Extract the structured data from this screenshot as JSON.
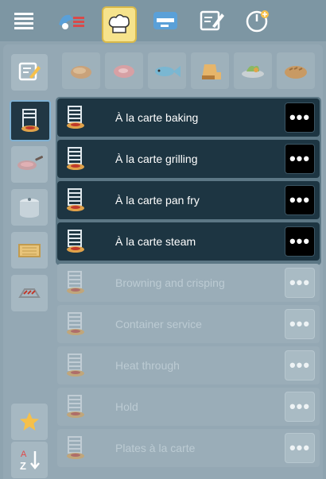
{
  "toolbar": {
    "buttons": [
      {
        "name": "menu",
        "icon": "hamburger-menu-icon"
      },
      {
        "name": "cook",
        "icon": "cooking-wizard-icon"
      },
      {
        "name": "chef",
        "icon": "chef-hat-icon",
        "active": true
      },
      {
        "name": "cabinet",
        "icon": "oven-cabinet-icon"
      },
      {
        "name": "edit",
        "icon": "edit-note-icon"
      },
      {
        "name": "timer",
        "icon": "timer-plus-icon"
      }
    ]
  },
  "categories": [
    {
      "name": "poultry",
      "icon": "poultry-icon"
    },
    {
      "name": "meat",
      "icon": "meat-icon"
    },
    {
      "name": "fish",
      "icon": "fish-icon"
    },
    {
      "name": "dessert",
      "icon": "dessert-icon"
    },
    {
      "name": "vegetables",
      "icon": "vegetables-icon"
    },
    {
      "name": "bakery",
      "icon": "bread-icon"
    }
  ],
  "sidebar": {
    "items": [
      {
        "name": "edit-recipe",
        "icon": "edit-recipe-icon"
      },
      {
        "name": "a-la-carte",
        "icon": "a-la-carte-icon",
        "active": true
      },
      {
        "name": "pan",
        "icon": "pan-icon"
      },
      {
        "name": "pot",
        "icon": "pot-icon"
      },
      {
        "name": "baking-tray",
        "icon": "baking-tray-icon"
      },
      {
        "name": "grill",
        "icon": "grill-icon"
      },
      {
        "name": "favorites",
        "icon": "star-icon"
      },
      {
        "name": "sort",
        "icon": "sort-az-icon"
      }
    ]
  },
  "programs": [
    {
      "label": "À la carte baking",
      "enabled": true
    },
    {
      "label": "À la carte grilling",
      "enabled": true
    },
    {
      "label": "À la carte pan fry",
      "enabled": true
    },
    {
      "label": "À la carte steam",
      "enabled": true
    },
    {
      "label": "Browning and crisping",
      "enabled": false
    },
    {
      "label": "Container service",
      "enabled": false
    },
    {
      "label": "Heat through",
      "enabled": false
    },
    {
      "label": "Hold",
      "enabled": false
    },
    {
      "label": "Plates à la carte",
      "enabled": false
    }
  ],
  "more_label": "•••",
  "colors": {
    "active_tab": "#f6e38c",
    "enabled_row": "#1d3542",
    "disabled_row": "#9aadb8",
    "background": "#8ea3af"
  }
}
